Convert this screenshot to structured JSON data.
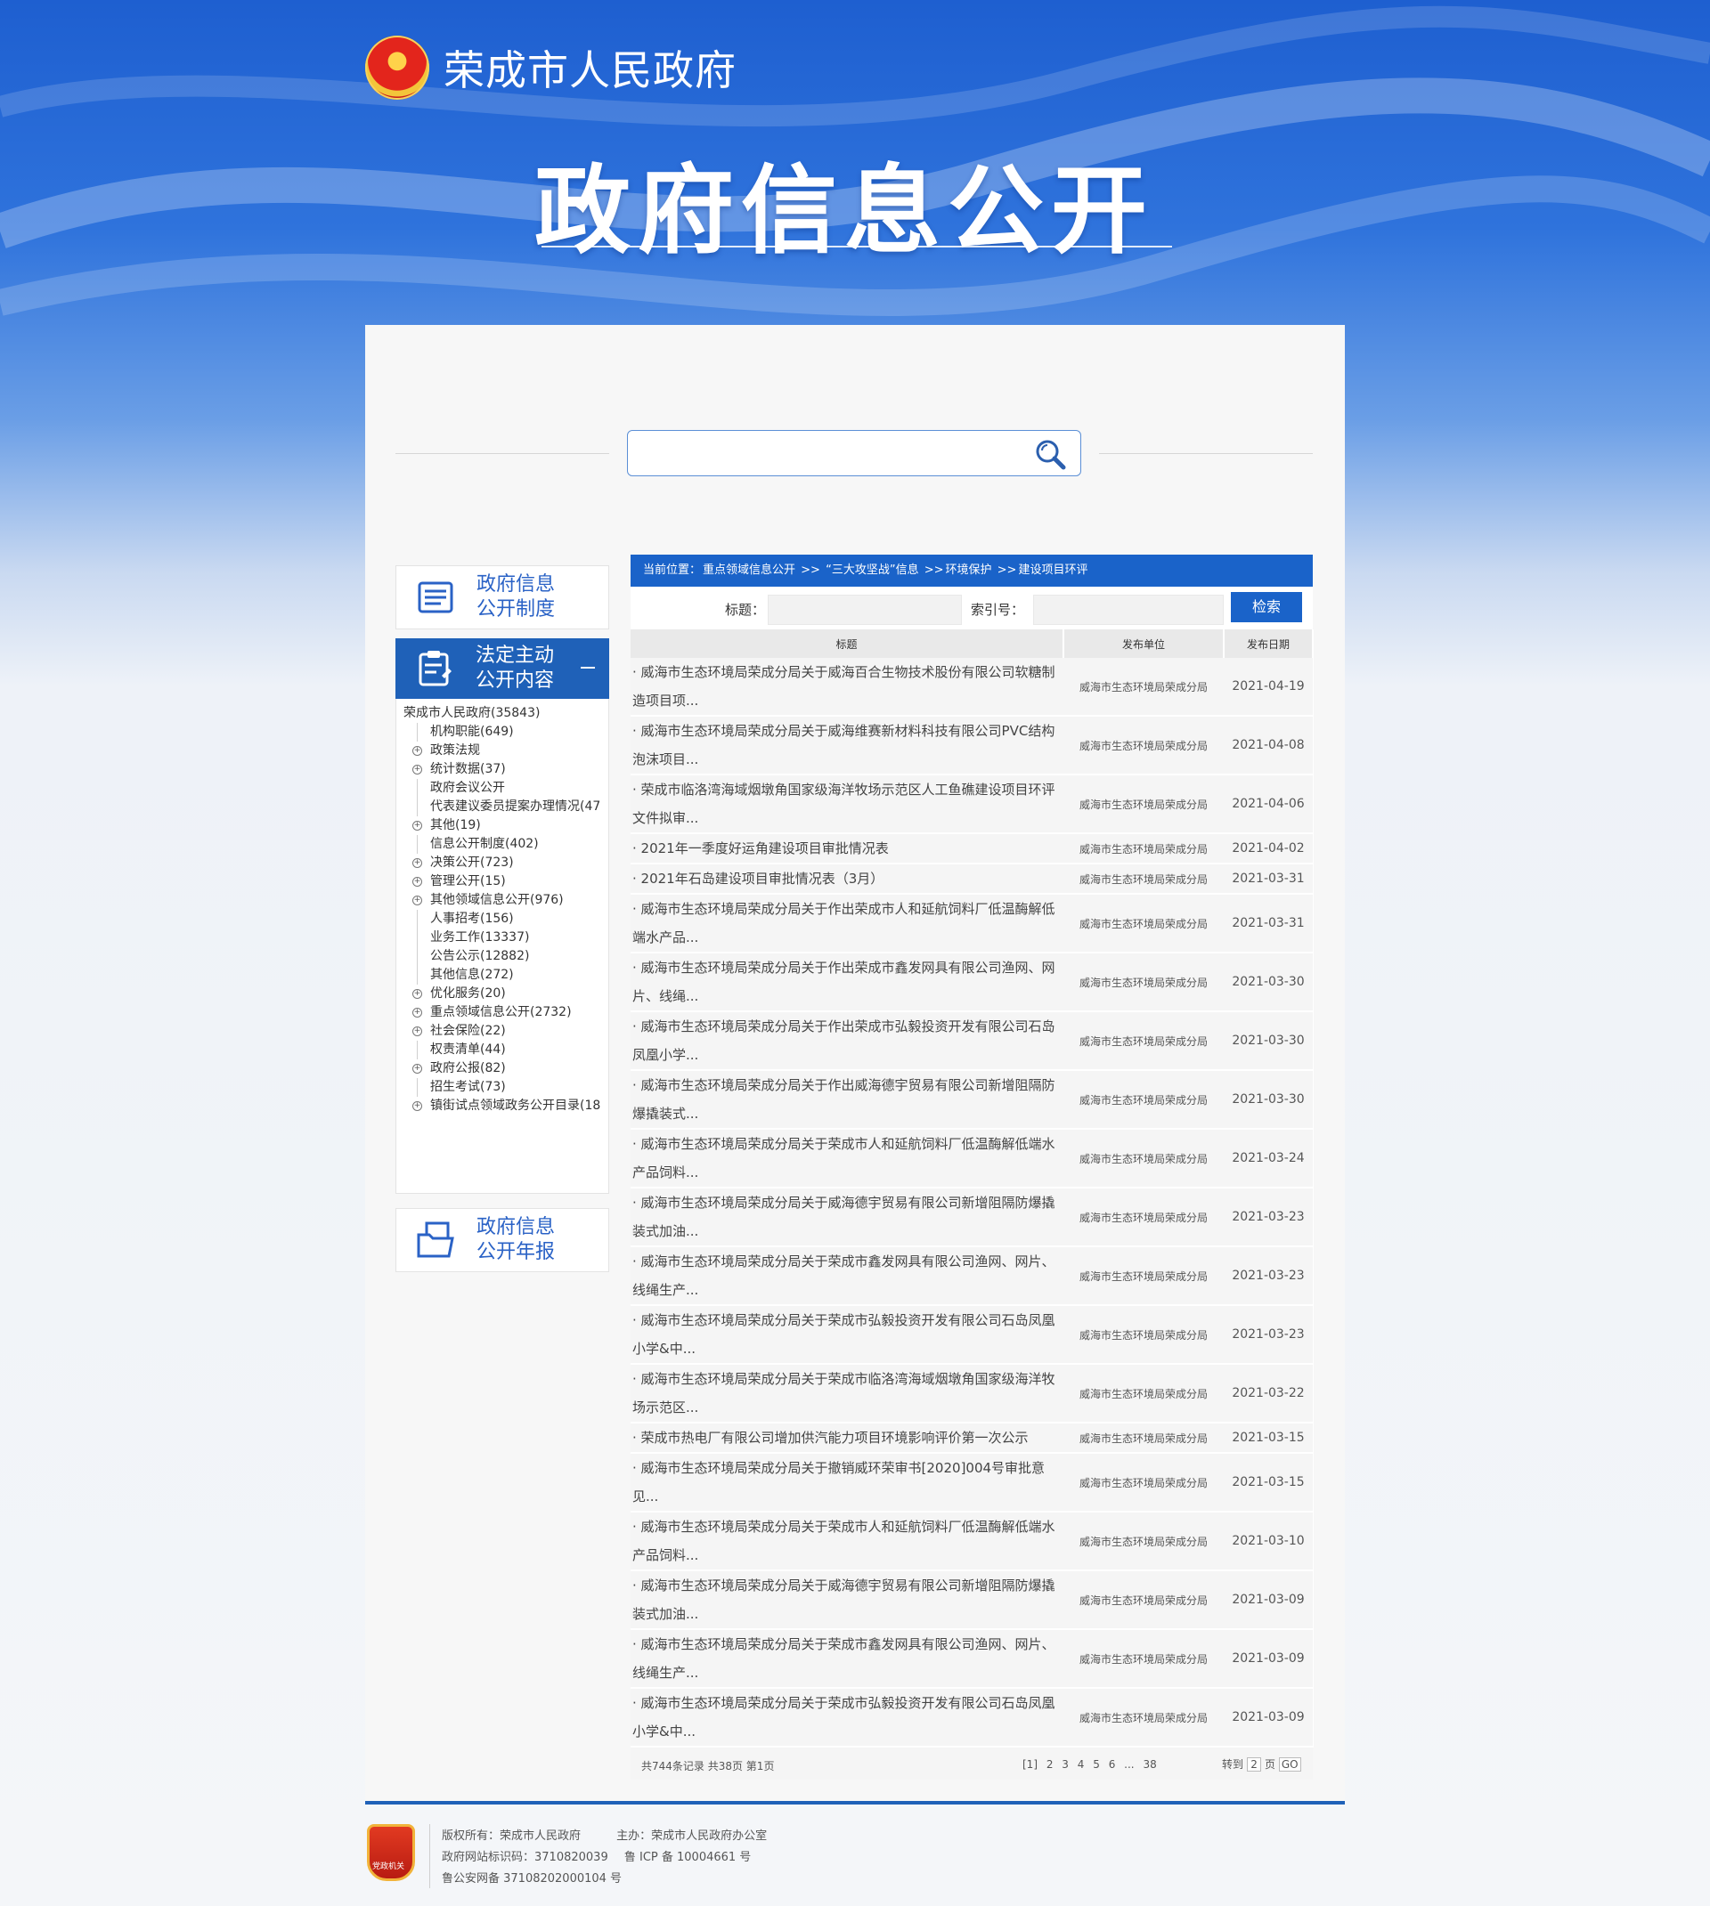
{
  "header": {
    "site_name": "荣成市人民政府",
    "big_title": "政府信息公开"
  },
  "side": {
    "card1": [
      "政府信息",
      "公开制度"
    ],
    "card2": [
      "法定主动",
      "公开内容"
    ],
    "card3": [
      "政府信息",
      "公开年报"
    ],
    "tree_root": "荣成市人民政府(35843)",
    "tree": [
      {
        "label": "机构职能(649)",
        "exp": false
      },
      {
        "label": "政策法规",
        "exp": true
      },
      {
        "label": "统计数据(37)",
        "exp": true
      },
      {
        "label": "政府会议公开",
        "exp": false
      },
      {
        "label": "代表建议委员提案办理情况(47",
        "exp": false
      },
      {
        "label": "其他(19)",
        "exp": true
      },
      {
        "label": "信息公开制度(402)",
        "exp": false
      },
      {
        "label": "决策公开(723)",
        "exp": true
      },
      {
        "label": "管理公开(15)",
        "exp": true
      },
      {
        "label": "其他领域信息公开(976)",
        "exp": true
      },
      {
        "label": "人事招考(156)",
        "exp": false
      },
      {
        "label": "业务工作(13337)",
        "exp": false
      },
      {
        "label": "公告公示(12882)",
        "exp": false
      },
      {
        "label": "其他信息(272)",
        "exp": false
      },
      {
        "label": "优化服务(20)",
        "exp": true
      },
      {
        "label": "重点领域信息公开(2732)",
        "exp": true
      },
      {
        "label": "社会保险(22)",
        "exp": true
      },
      {
        "label": "权责清单(44)",
        "exp": false
      },
      {
        "label": "政府公报(82)",
        "exp": true
      },
      {
        "label": "招生考试(73)",
        "exp": false
      },
      {
        "label": "镇街试点领域政务公开目录(18",
        "exp": true
      }
    ]
  },
  "main": {
    "breadcrumb": [
      "当前位置：",
      "重点领域信息公开",
      " >> ",
      "“三大攻坚战”信息",
      " >>",
      "环境保护",
      " >>",
      "建设项目环评"
    ],
    "filter": {
      "title_label": "标题：",
      "index_label": "索引号：",
      "search_button": "检索"
    },
    "table_headers": [
      "标题",
      "发布单位",
      "发布日期"
    ],
    "rows": [
      {
        "title": "· 威海市生态环境局荣成分局关于威海百合生物技术股份有限公司软糖制造项目项...",
        "unit": "威海市生态环境局荣成分局",
        "date": "2021-04-19",
        "h": 64
      },
      {
        "title": "· 威海市生态环境局荣成分局关于威海维赛新材料科技有限公司PVC结构泡沫项目...",
        "unit": "威海市生态环境局荣成分局",
        "date": "2021-04-08",
        "h": 64
      },
      {
        "title": "· 荣成市临洛湾海域烟墩角国家级海洋牧场示范区人工鱼礁建设项目环评文件拟审...",
        "unit": "威海市生态环境局荣成分局",
        "date": "2021-04-06",
        "h": 64
      },
      {
        "title": "· 2021年一季度好运角建设项目审批情况表",
        "unit": "威海市生态环境局荣成分局",
        "date": "2021-04-02",
        "h": 32
      },
      {
        "title": "· 2021年石岛建设项目审批情况表（3月）",
        "unit": "威海市生态环境局荣成分局",
        "date": "2021-03-31",
        "h": 32
      },
      {
        "title": "· 威海市生态环境局荣成分局关于作出荣成市人和延航饲料厂低温酶解低端水产品...",
        "unit": "威海市生态环境局荣成分局",
        "date": "2021-03-31",
        "h": 64
      },
      {
        "title": "· 威海市生态环境局荣成分局关于作出荣成市鑫发网具有限公司渔网、网片、线绳...",
        "unit": "威海市生态环境局荣成分局",
        "date": "2021-03-30",
        "h": 64
      },
      {
        "title": "· 威海市生态环境局荣成分局关于作出荣成市弘毅投资开发有限公司石岛凤凰小学...",
        "unit": "威海市生态环境局荣成分局",
        "date": "2021-03-30",
        "h": 64
      },
      {
        "title": "· 威海市生态环境局荣成分局关于作出威海德宇贸易有限公司新增阻隔防爆撬装式...",
        "unit": "威海市生态环境局荣成分局",
        "date": "2021-03-30",
        "h": 64
      },
      {
        "title": "· 威海市生态环境局荣成分局关于荣成市人和延航饲料厂低温酶解低端水产品饲料...",
        "unit": "威海市生态环境局荣成分局",
        "date": "2021-03-24",
        "h": 64
      },
      {
        "title": "· 威海市生态环境局荣成分局关于威海德宇贸易有限公司新增阻隔防爆撬装式加油...",
        "unit": "威海市生态环境局荣成分局",
        "date": "2021-03-23",
        "h": 64
      },
      {
        "title": "· 威海市生态环境局荣成分局关于荣成市鑫发网具有限公司渔网、网片、线绳生产...",
        "unit": "威海市生态环境局荣成分局",
        "date": "2021-03-23",
        "h": 64
      },
      {
        "title": "· 威海市生态环境局荣成分局关于荣成市弘毅投资开发有限公司石岛凤凰小学&中...",
        "unit": "威海市生态环境局荣成分局",
        "date": "2021-03-23",
        "h": 64
      },
      {
        "title": "· 威海市生态环境局荣成分局关于荣成市临洛湾海域烟墩角国家级海洋牧场示范区...",
        "unit": "威海市生态环境局荣成分局",
        "date": "2021-03-22",
        "h": 64
      },
      {
        "title": "· 荣成市热电厂有限公司增加供汽能力项目环境影响评价第一次公示",
        "unit": "威海市生态环境局荣成分局",
        "date": "2021-03-15",
        "h": 32
      },
      {
        "title": "· 威海市生态环境局荣成分局关于撤销威环荣审书[2020]004号审批意见...",
        "unit": "威海市生态环境局荣成分局",
        "date": "2021-03-15",
        "h": 64
      },
      {
        "title": "· 威海市生态环境局荣成分局关于荣成市人和延航饲料厂低温酶解低端水产品饲料...",
        "unit": "威海市生态环境局荣成分局",
        "date": "2021-03-10",
        "h": 64
      },
      {
        "title": "· 威海市生态环境局荣成分局关于威海德宇贸易有限公司新增阻隔防爆撬装式加油...",
        "unit": "威海市生态环境局荣成分局",
        "date": "2021-03-09",
        "h": 64
      },
      {
        "title": "· 威海市生态环境局荣成分局关于荣成市鑫发网具有限公司渔网、网片、线绳生产...",
        "unit": "威海市生态环境局荣成分局",
        "date": "2021-03-09",
        "h": 64
      },
      {
        "title": "· 威海市生态环境局荣成分局关于荣成市弘毅投资开发有限公司石岛凤凰小学&中...",
        "unit": "威海市生态环境局荣成分局",
        "date": "2021-03-09",
        "h": 64
      }
    ],
    "pager": {
      "summary": "共744条记录  共38页  第1页",
      "pages": [
        "[1]",
        "2",
        "3",
        "4",
        "5",
        "6",
        "...",
        "38"
      ],
      "jump_label": "转到",
      "jump_value": "2",
      "page_unit": "页",
      "go": "GO"
    }
  },
  "footer": {
    "badge_text": "党政机关",
    "line1a": "版权所有：荣成市人民政府",
    "line1b": "主办：荣成市人民政府办公室",
    "line2a": "政府网站标识码：3710820039",
    "line2b": "鲁 ICP 备 10004661 号",
    "line3": "鲁公安网备 37108202000104 号"
  }
}
